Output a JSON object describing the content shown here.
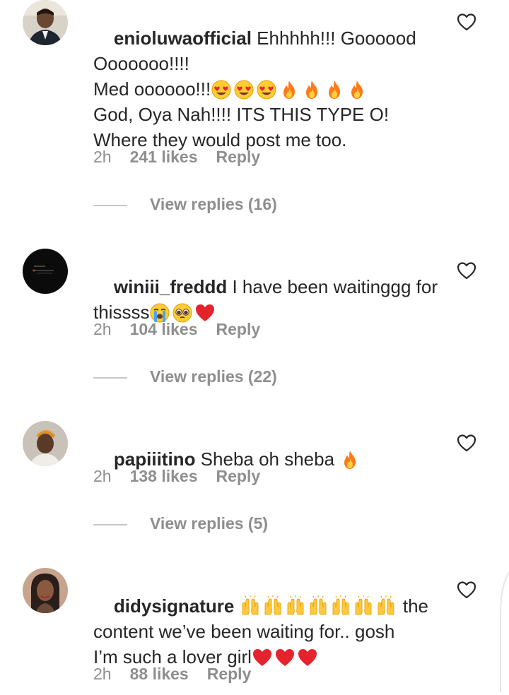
{
  "comments": [
    {
      "username": "enioluwaofficial",
      "text_before": " Ehhhhh!!! Goooood\nOoooooo!!!!\nMed oooooo!!!",
      "emojis": [
        "heart-eyes",
        "heart-eyes",
        "heart-eyes",
        "fire",
        "fire",
        "fire",
        "fire"
      ],
      "text_after": "\nGod, Oya Nah!!!! ITS THIS TYPE O!\nWhere they would post me too.",
      "time": "2h",
      "likes": "241 likes",
      "reply": "Reply",
      "view_replies": "View replies (16)"
    },
    {
      "username": "winiii_freddd",
      "text_before": " I have been waitinggg for\nthissss",
      "emojis": [
        "loudly-crying",
        "pleading",
        "red-heart"
      ],
      "text_after": "",
      "time": "2h",
      "likes": "104 likes",
      "reply": "Reply",
      "view_replies": "View replies (22)"
    },
    {
      "username": "papiiitino",
      "text_before": " Sheba oh sheba ",
      "emojis": [
        "fire"
      ],
      "text_after": "",
      "time": "2h",
      "likes": "138 likes",
      "reply": "Reply",
      "view_replies": "View replies (5)"
    },
    {
      "username": "didysignature",
      "text_before": " ",
      "emojis": [
        "raising-hands",
        "raising-hands",
        "raising-hands",
        "raising-hands",
        "raising-hands",
        "raising-hands",
        "raising-hands"
      ],
      "text_after": " the\ncontent we’ve been waiting for.. gosh\nI’m such a lover girl",
      "emojis_end": [
        "red-heart",
        "red-heart",
        "red-heart"
      ],
      "time": "2h",
      "likes": "88 likes",
      "reply": "Reply"
    }
  ],
  "icons": {
    "like": "heart-outline-icon"
  },
  "colors": {
    "text": "#262626",
    "secondary": "#8e8e8e",
    "rule": "#c7c7c7"
  }
}
